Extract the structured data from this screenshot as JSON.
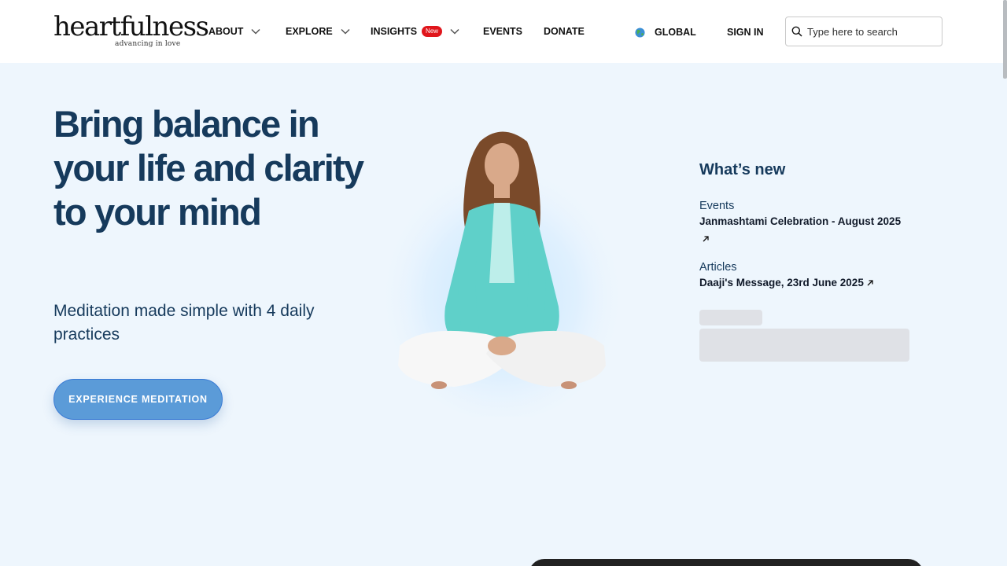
{
  "logo": {
    "main": "heartfulness",
    "tagline": "advancing in love"
  },
  "nav": {
    "about": "ABOUT",
    "explore": "EXPLORE",
    "insights": "INSIGHTS",
    "insights_badge": "New",
    "events": "EVENTS",
    "donate": "DONATE",
    "region": "GLOBAL",
    "sign_in": "SIGN IN"
  },
  "search": {
    "placeholder": "Type here to search"
  },
  "hero": {
    "title": "Bring balance in your life and clarity to your mind",
    "subtitle": "Meditation made simple with 4 daily practices",
    "cta": "EXPERIENCE MEDITATION"
  },
  "whats_new": {
    "title": "What’s new",
    "items": [
      {
        "category": "Events",
        "link": "Janmashtami Celebration - August 2025"
      },
      {
        "category": "Articles",
        "link": "Daaji's Message, 23rd June 2025"
      }
    ]
  },
  "colors": {
    "primary": "#163a5c",
    "accent": "#5b9bd8",
    "badge": "#e0161c",
    "background": "#eef6fd"
  }
}
